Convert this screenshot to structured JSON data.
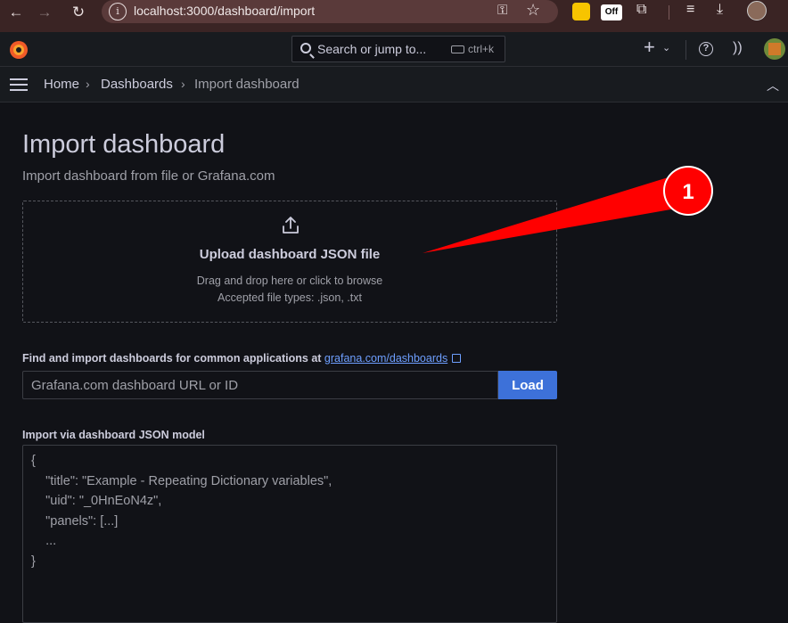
{
  "browser": {
    "url": "localhost:3000/dashboard/import",
    "back_icon": "arrow-left-icon",
    "forward_icon": "arrow-right-icon",
    "reload_icon": "reload-icon",
    "extension_off_label": "Off"
  },
  "topnav": {
    "search_placeholder": "Search or jump to...",
    "search_shortcut": "ctrl+k",
    "new_icon": "plus-icon",
    "help_icon_glyph": "?"
  },
  "breadcrumb": {
    "items": [
      "Home",
      "Dashboards",
      "Import dashboard"
    ],
    "separator": "›"
  },
  "page": {
    "title": "Import dashboard",
    "subtitle": "Import dashboard from file or Grafana.com"
  },
  "upload": {
    "title": "Upload dashboard JSON file",
    "hint": "Drag and drop here or click to browse",
    "types": "Accepted file types: .json, .txt"
  },
  "gcom": {
    "label_prefix": "Find and import dashboards for common applications at ",
    "link_text": "grafana.com/dashboards",
    "input_placeholder": "Grafana.com dashboard URL or ID",
    "load_label": "Load"
  },
  "json_model": {
    "label": "Import via dashboard JSON model",
    "lines": [
      "{",
      "    \"title\": \"Example - Repeating Dictionary variables\",",
      "    \"uid\": \"_0HnEoN4z\",",
      "    \"panels\": [...]",
      "    ...",
      "}"
    ]
  },
  "annotation": {
    "number": "1",
    "color": "#ff0000"
  },
  "colors": {
    "accent": "#3d71d9",
    "link": "#6e9fff",
    "background": "#111217",
    "panel": "#181b1f"
  }
}
